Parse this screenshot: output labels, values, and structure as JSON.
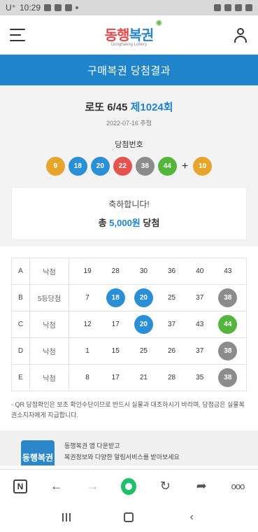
{
  "status_bar": {
    "carrier": "U⁺",
    "time": "10:29",
    "battery_icon": "battery-icon",
    "wifi_icon": "wifi-icon"
  },
  "header": {
    "logo_main_1": "동행",
    "logo_main_2": "복권",
    "logo_sub": "Donghaeng Lottery"
  },
  "title_band": "구매복권 당첨결과",
  "draw": {
    "game": "로또 6/45",
    "round": "제1024회",
    "date": "2022-07-16 추첨",
    "win_label": "당첨번호",
    "numbers": [
      9,
      18,
      20,
      22,
      38,
      44
    ],
    "bonus": 10,
    "ball_colors": {
      "yellow": "#e5a62b",
      "blue": "#2b8fd6",
      "red": "#e5534f",
      "gray": "#8c8c8c",
      "green": "#54b53c"
    }
  },
  "prize": {
    "congrats": "축하합니다!",
    "prefix": "총",
    "amount": "5,000원",
    "suffix": "당첨"
  },
  "results": [
    {
      "set": "A",
      "result": "낙첨",
      "numbers": [
        19,
        28,
        30,
        36,
        40,
        43
      ]
    },
    {
      "set": "B",
      "result": "5등당첨",
      "numbers": [
        7,
        18,
        20,
        25,
        37,
        38
      ]
    },
    {
      "set": "C",
      "result": "낙첨",
      "numbers": [
        12,
        17,
        20,
        37,
        43,
        44
      ]
    },
    {
      "set": "D",
      "result": "낙첨",
      "numbers": [
        1,
        15,
        25,
        26,
        37,
        38
      ]
    },
    {
      "set": "E",
      "result": "낙첨",
      "numbers": [
        8,
        17,
        21,
        28,
        35,
        38
      ]
    }
  ],
  "note": "- QR 당첨확인은 보조 확인수단이므로 반드시 실물과 대조하시기 바라며, 당첨금은 실물복권소지자에게 지급합니다.",
  "promo": {
    "logo": "동행복권",
    "line1": "동행복권 앱 다운받고",
    "line2": "복권정보와 다양한 알림서비스를 받아보세요"
  },
  "browser_bar": {
    "n_label": "N",
    "more": "ooo"
  }
}
